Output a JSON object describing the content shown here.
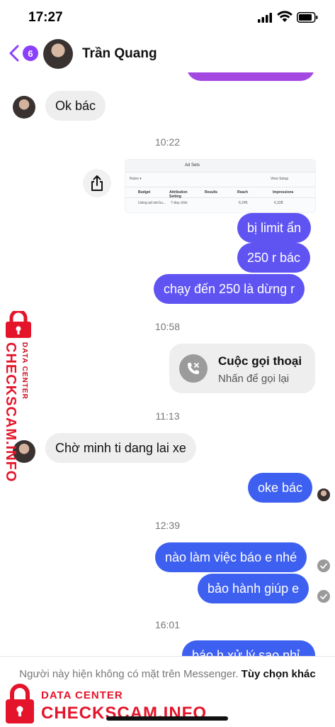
{
  "status": {
    "time": "17:27"
  },
  "header": {
    "back_badge": "6",
    "contact_name": "Trần Quang"
  },
  "messages": {
    "m1": "Ok bác",
    "ts1": "10:22",
    "screenshot": {
      "tab": "Ad Sets",
      "rules": "Rules ▾",
      "view_setup": "View Setup",
      "headers": [
        "Budget",
        "Attribution Setting",
        "Results",
        "Reach",
        "Impressions"
      ],
      "cells": [
        "Using ad set bu...",
        "7-day click",
        "6,245",
        "6,328"
      ]
    },
    "m2": "bị limit ẩn",
    "m3": "250 r bác",
    "m4": "chạy đến 250 là dừng r",
    "ts2": "10:58",
    "call_title": "Cuộc gọi thoại",
    "call_sub": "Nhấn để gọi lại",
    "ts3": "11:13",
    "m5": "Chờ minh ti dang lai xe",
    "m6": "oke bác",
    "ts4": "12:39",
    "m7": "nào làm việc báo e nhé",
    "m8": "bảo hành giúp e",
    "ts5": "16:01",
    "m9": "báo h xử lý sao nhỉ"
  },
  "footer": {
    "notice": "Người này hiện không có mặt trên Messenger.",
    "link": "Tùy chọn khác"
  },
  "watermark": {
    "small": "DATA CENTER",
    "big": "CHECKSCAM.INFO"
  },
  "colors": {
    "outgoing_purple": "#5f54f2",
    "outgoing_blue": "#3e60f0",
    "incoming_gray": "#eeeeee",
    "accent_purple": "#8a3ffc",
    "watermark_red": "#e4152b"
  }
}
